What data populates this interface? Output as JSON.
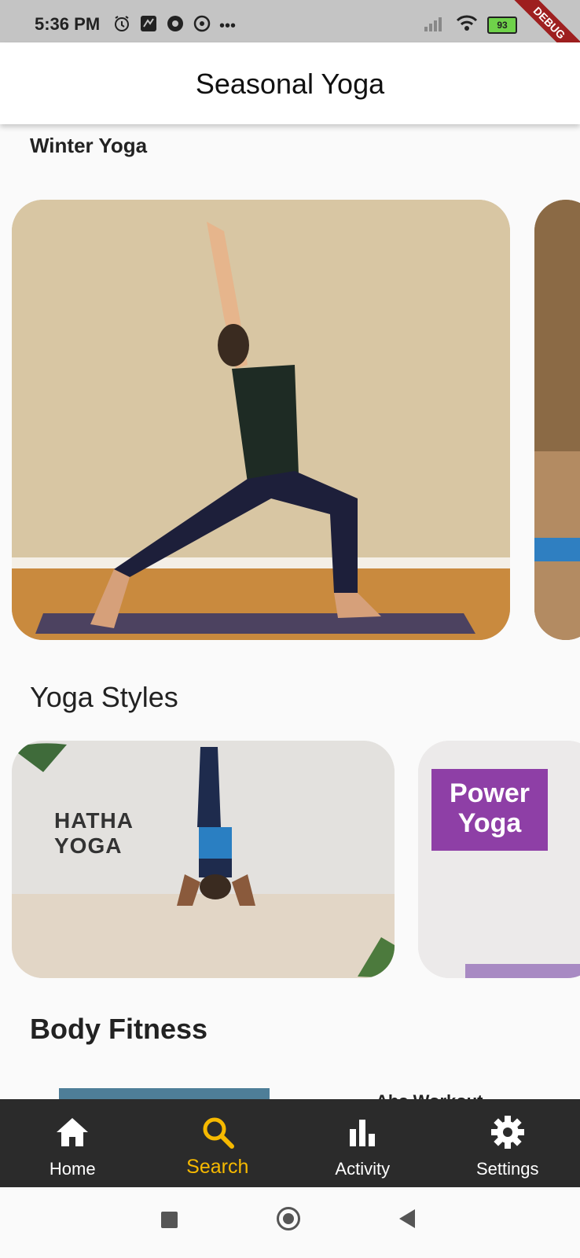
{
  "status_bar": {
    "time": "5:36 PM",
    "more": "•••",
    "battery": "93",
    "debug_label": "DEBUG"
  },
  "app_bar": {
    "title": "Seasonal Yoga"
  },
  "winter": {
    "label": "Winter Yoga"
  },
  "styles": {
    "label": "Yoga Styles",
    "cards": [
      {
        "text_line1": "HATHA",
        "text_line2": "YOGA"
      },
      {
        "text_line1": "Power",
        "text_line2": "Yoga"
      }
    ]
  },
  "fitness": {
    "label": "Body Fitness",
    "peek_text": "Abs Workout"
  },
  "bottom_nav": {
    "items": [
      {
        "label": "Home",
        "icon": "home-icon"
      },
      {
        "label": "Search",
        "icon": "search-icon"
      },
      {
        "label": "Activity",
        "icon": "bar-chart-icon"
      },
      {
        "label": "Settings",
        "icon": "gear-icon"
      }
    ],
    "active_color": "#f6b900"
  }
}
